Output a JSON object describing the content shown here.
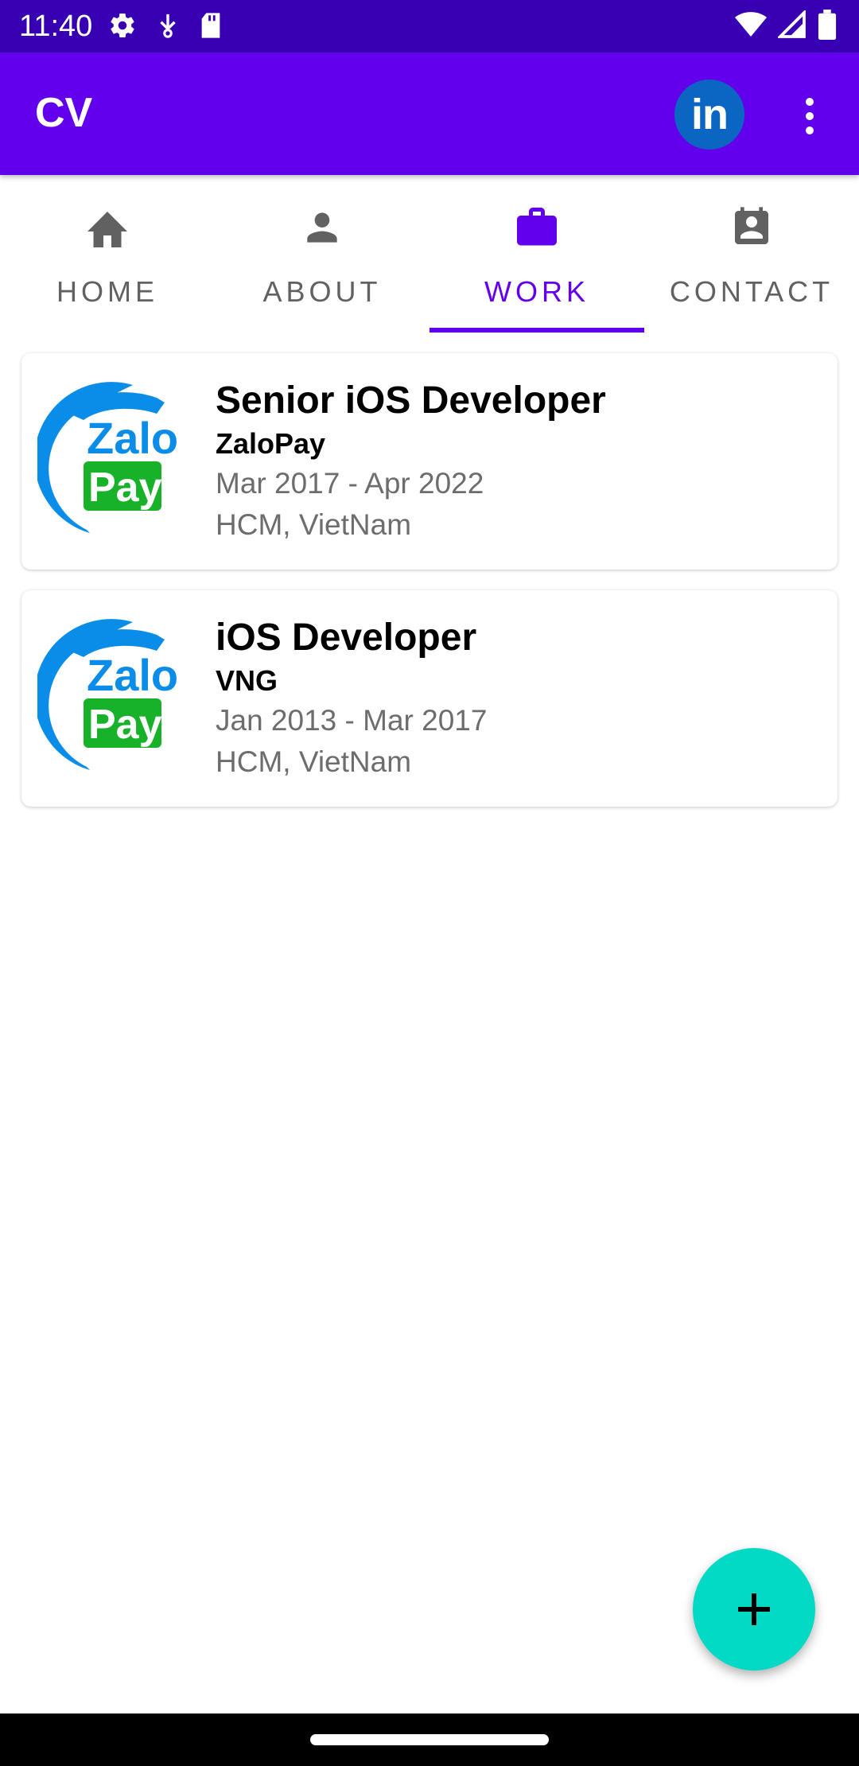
{
  "status_bar": {
    "time": "11:40",
    "icons_left": [
      "settings-icon",
      "download-icon",
      "sd-card-icon"
    ],
    "icons_right": [
      "wifi-icon",
      "signal-icon",
      "battery-icon"
    ]
  },
  "app_bar": {
    "title": "CV",
    "linkedin_label": "in",
    "color": "#6200ee"
  },
  "tabs": [
    {
      "label": "HOME",
      "icon": "home-icon",
      "active": false
    },
    {
      "label": "ABOUT",
      "icon": "person-icon",
      "active": false
    },
    {
      "label": "WORK",
      "icon": "briefcase-icon",
      "active": true
    },
    {
      "label": "CONTACT",
      "icon": "contact-card-icon",
      "active": false
    }
  ],
  "jobs": [
    {
      "title": "Senior iOS Developer",
      "company": "ZaloPay",
      "period": "Mar 2017 - Apr 2022",
      "location": "HCM, VietNam",
      "logo": {
        "line1": "Zalo",
        "line2": "Pay"
      }
    },
    {
      "title": "iOS Developer",
      "company": "VNG",
      "period": "Jan 2013 - Mar 2017",
      "location": "HCM, VietNam",
      "logo": {
        "line1": "Zalo",
        "line2": "Pay"
      }
    }
  ],
  "fab": {
    "icon": "plus-icon",
    "color": "#03dac5"
  },
  "colors": {
    "status_bar": "#3700b3",
    "primary": "#6200ee",
    "zalo_blue": "#0a8de8",
    "zalo_green": "#17b12a"
  }
}
